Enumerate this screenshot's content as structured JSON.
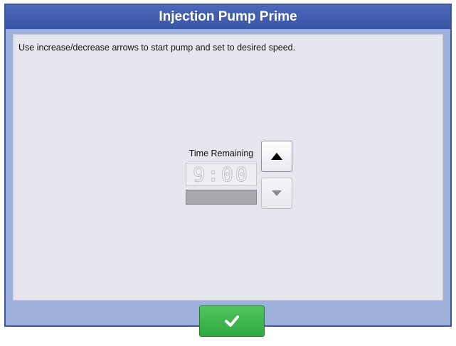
{
  "dialog": {
    "title": "Injection Pump Prime",
    "instruction": "Use increase/decrease arrows to start pump and set to desired speed."
  },
  "timer": {
    "label": "Time Remaining",
    "value": "9:00",
    "progress_fraction": 0
  },
  "controls": {
    "increase_icon": "triangle-up-icon",
    "decrease_icon": "triangle-down-icon",
    "ok_icon": "checkmark-icon"
  },
  "colors": {
    "title_bar": "#3f57a0",
    "background": "#9eb0dc",
    "content": "#e6e6ef",
    "ok_button": "#39b54a",
    "up_arrow": "#000000",
    "down_arrow_disabled": "#8a8a94"
  }
}
